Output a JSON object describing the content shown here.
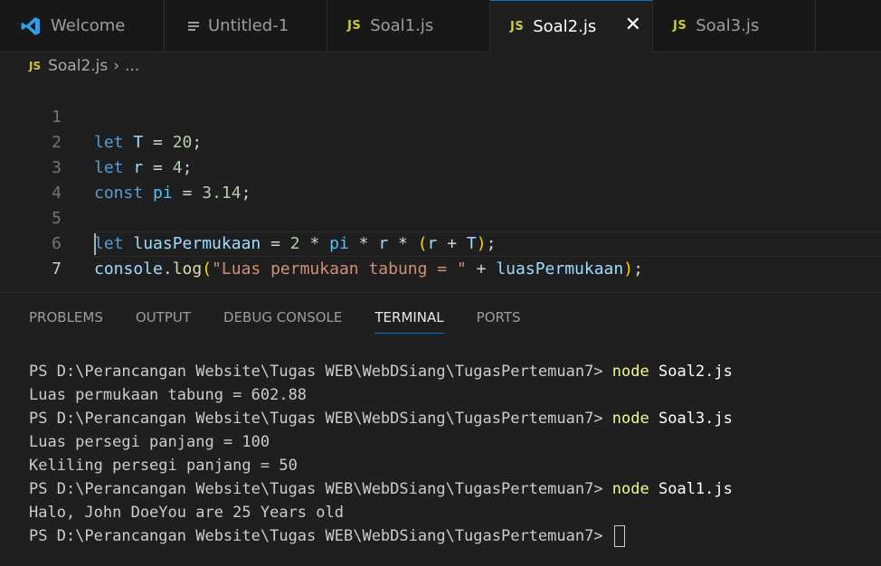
{
  "tabs": [
    {
      "label": "Welcome",
      "icon": "vscode-logo-icon"
    },
    {
      "label": "Untitled-1",
      "icon": "lines-icon"
    },
    {
      "label": "Soal1.js",
      "icon": "js-icon"
    },
    {
      "label": "Soal2.js",
      "icon": "js-icon",
      "active": true
    },
    {
      "label": "Soal3.js",
      "icon": "js-icon"
    }
  ],
  "js_badge": "JS",
  "close_glyph": "✕",
  "breadcrumb": {
    "file": "Soal2.js",
    "more": "..."
  },
  "editor": {
    "line_numbers": [
      "1",
      "2",
      "3",
      "4",
      "5",
      "6",
      "7"
    ],
    "line1": {
      "kw": "let",
      "var": "T",
      "eq": " = ",
      "num": "20",
      "end": ";"
    },
    "line2": {
      "kw": "let",
      "var": "r",
      "eq": " = ",
      "num": "4",
      "end": ";"
    },
    "line3": {
      "kw": "const",
      "var": "pi",
      "eq": " = ",
      "num": "3.14",
      "end": ";"
    },
    "line5": {
      "kw": "let",
      "var": "luasPermukaan",
      "eq": " = ",
      "num": "2",
      "op1": " * ",
      "v2": "pi",
      "op2": " * ",
      "v3": "r",
      "op3": " * ",
      "po": "(",
      "v4": "r",
      "op4": " + ",
      "v5": "T",
      "pc": ")",
      "end": ";"
    },
    "line6": {
      "obj": "console",
      "dot": ".",
      "fn": "log",
      "po": "(",
      "str": "\"Luas permukaan tabung = \"",
      "op": " + ",
      "var": "luasPermukaan",
      "pc": ")",
      "end": ";"
    }
  },
  "panel_tabs": [
    "PROBLEMS",
    "OUTPUT",
    "DEBUG CONSOLE",
    "TERMINAL",
    "PORTS"
  ],
  "terminal": {
    "prompt": "PS D:\\Perancangan Website\\Tugas WEB\\WebDSiang\\TugasPertemuan7> ",
    "cmd": "node",
    "run1": " Soal2.js",
    "out1": "Luas permukaan tabung = 602.88",
    "run2": " Soal3.js",
    "out2a": "Luas persegi panjang = 100",
    "out2b": "Keliling persegi panjang = 50",
    "run3": " Soal1.js",
    "out3": "Halo, John DoeYou are 25 Years old"
  },
  "colors": {
    "accent": "#0078d4",
    "js_icon": "#cbcb41",
    "background": "#1f1f1f"
  }
}
